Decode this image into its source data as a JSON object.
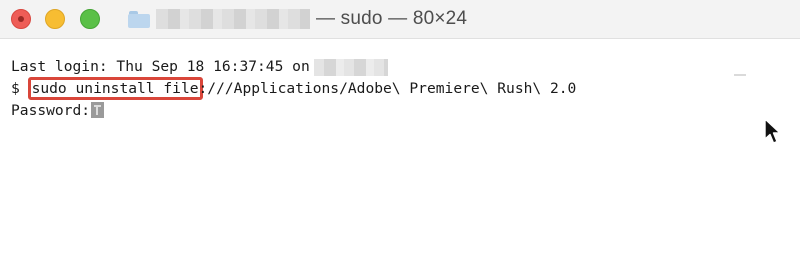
{
  "titlebar": {
    "title_suffix": "— sudo — 80×24",
    "icons": {
      "close": "close-button",
      "minimize": "minimize-button",
      "zoom": "zoom-button",
      "folder": "folder-icon"
    },
    "colors": {
      "close": "#ee5d57",
      "minimize": "#f7bd32",
      "zoom": "#5ac047"
    }
  },
  "terminal": {
    "last_login": "Last login: Thu Sep 18 16:37:45 on",
    "prompt": "$ ",
    "command_highlighted": "sudo uninstall file",
    "command_rest": ":///Applications/Adobe\\ Premiere\\ Rush\\ 2.0",
    "password_prompt": "Password:",
    "highlight_color": "#d9463a",
    "cursor_icon": "key-icon",
    "pointer_icon": "mouse-pointer-icon"
  }
}
